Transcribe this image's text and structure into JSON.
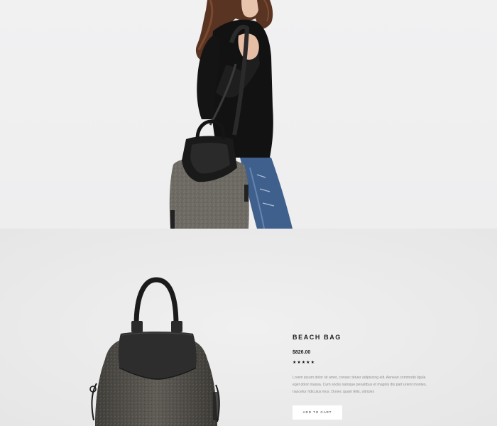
{
  "product": {
    "title": "BEACH BAG",
    "price": "$826.00",
    "rating": 5,
    "rating_max": 5,
    "description": "Lorem ipsum dolor sit amet, consec tetuer adipiscing elit. Aenean commodo ligula eget dolor massa. Cum sociis natoque penatibus et magnis dis part urient montes, nascetur ridiculus mus. Donec quam felis, ultricies",
    "add_to_cart_label": "ADD TO CART"
  },
  "colors": {
    "hero_background": "#efeff0",
    "product_background": "#ececec",
    "button_background": "#ffffff",
    "title_color": "#1d1d1d",
    "description_color": "#8f8f8f"
  }
}
